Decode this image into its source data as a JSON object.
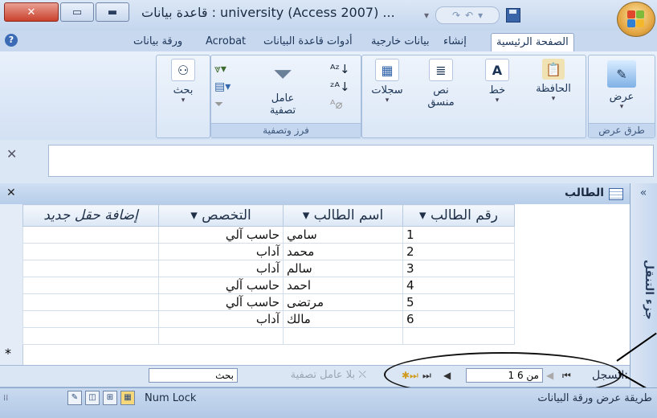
{
  "window": {
    "title": "Microsoft Access - university : قاعدة بيانات (Access 2007) ...",
    "title_visible": "قاعدة بيانات : university (Access 2007) ..."
  },
  "tabs": [
    "الصفحة الرئيسية",
    "إنشاء",
    "بيانات خارجية",
    "أدوات قاعدة البيانات",
    "Acrobat",
    "ورقة بيانات"
  ],
  "ribbon": {
    "view": {
      "label": "عرض",
      "group": "طرق عرض"
    },
    "clipboard": {
      "label": "الحافظة"
    },
    "font": {
      "label": "خط"
    },
    "rich_text": {
      "label": "نص منسق"
    },
    "records": {
      "label": "سجلات"
    },
    "filter": {
      "label": "عامل تصفية",
      "group": "فرز وتصفية"
    },
    "find": {
      "label": "بحث"
    }
  },
  "datasheet": {
    "title": "الطالب",
    "columns": [
      "رقم الطالب",
      "اسم الطالب",
      "التخصص",
      "إضافة حقل جديد"
    ],
    "rows": [
      {
        "id": "1",
        "name": "سامي",
        "major": "حاسب آلي"
      },
      {
        "id": "2",
        "name": "محمد",
        "major": "آداب"
      },
      {
        "id": "3",
        "name": "سالم",
        "major": "آداب"
      },
      {
        "id": "4",
        "name": "احمد",
        "major": "حاسب آلي"
      },
      {
        "id": "5",
        "name": "مرتضى",
        "major": "حاسب آلي"
      },
      {
        "id": "6",
        "name": "مالك",
        "major": "آداب"
      }
    ],
    "new_row_marker": "*"
  },
  "navpane": {
    "label": "جزء التنقل",
    "toggle": "«"
  },
  "record_nav": {
    "label": "السجل:",
    "position": "1 من 6",
    "no_filter": "بلا عامل تصفية",
    "search": "بحث"
  },
  "status": {
    "text": "طريقة عرض ورقة البيانات",
    "numlock": "Num Lock"
  }
}
